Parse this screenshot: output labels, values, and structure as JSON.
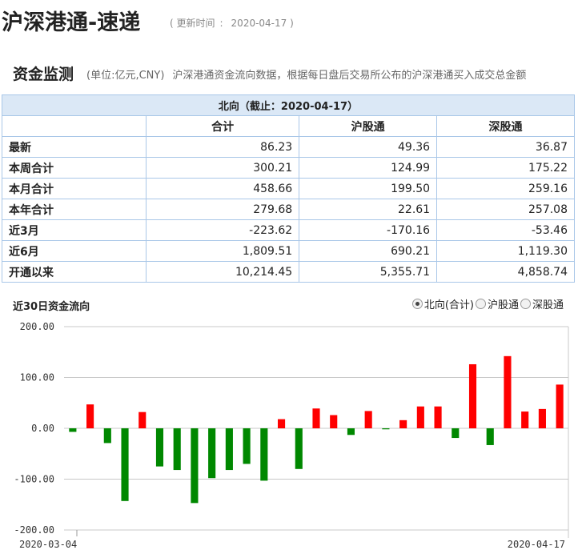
{
  "header": {
    "title": "沪深港通-速递",
    "update_label": "( 更新时间",
    "update_sep": ":",
    "update_date": "2020-04-17 )"
  },
  "section": {
    "title": "资金监测",
    "unit": "(单位:亿元,CNY)",
    "description": "沪深港通资金流向数据，根据每日盘后交易所公布的沪深港通买入成交总金额"
  },
  "table": {
    "caption": "北向（截止：2020-04-17）",
    "columns": [
      "合计",
      "沪股通",
      "深股通"
    ],
    "rows": [
      {
        "label": "最新",
        "values": [
          "86.23",
          "49.36",
          "36.87"
        ]
      },
      {
        "label": "本周合计",
        "values": [
          "300.21",
          "124.99",
          "175.22"
        ]
      },
      {
        "label": "本月合计",
        "values": [
          "458.66",
          "199.50",
          "259.16"
        ]
      },
      {
        "label": "本年合计",
        "values": [
          "279.68",
          "22.61",
          "257.08"
        ]
      },
      {
        "label": "近3月",
        "values": [
          "-223.62",
          "-170.16",
          "-53.46"
        ]
      },
      {
        "label": "近6月",
        "values": [
          "1,809.51",
          "690.21",
          "1,119.30"
        ]
      },
      {
        "label": "开通以来",
        "values": [
          "10,214.45",
          "5,355.71",
          "4,858.74"
        ]
      }
    ]
  },
  "chart_panel": {
    "title": "近30日资金流向",
    "options": [
      {
        "label": "北向(合计)",
        "checked": true
      },
      {
        "label": "沪股通",
        "checked": false
      },
      {
        "label": "深股通",
        "checked": false
      }
    ]
  },
  "chart_data": {
    "type": "bar",
    "x_start_label": "2020-03-04",
    "x_end_label": "2020-04-17",
    "yticks": [
      "200.00",
      "100.00",
      "0.00",
      "-100.00",
      "-200.00"
    ],
    "ylim": [
      -200,
      200
    ],
    "positive_color": "#ff0000",
    "negative_color": "#008800",
    "values": [
      -7,
      47,
      -29,
      -143,
      32,
      -75,
      -82,
      -147,
      -98,
      -82,
      -70,
      -103,
      18,
      -80,
      39,
      26,
      -13,
      34,
      -2,
      16,
      43,
      43,
      -19,
      126,
      -33,
      142,
      33,
      38,
      86
    ]
  }
}
